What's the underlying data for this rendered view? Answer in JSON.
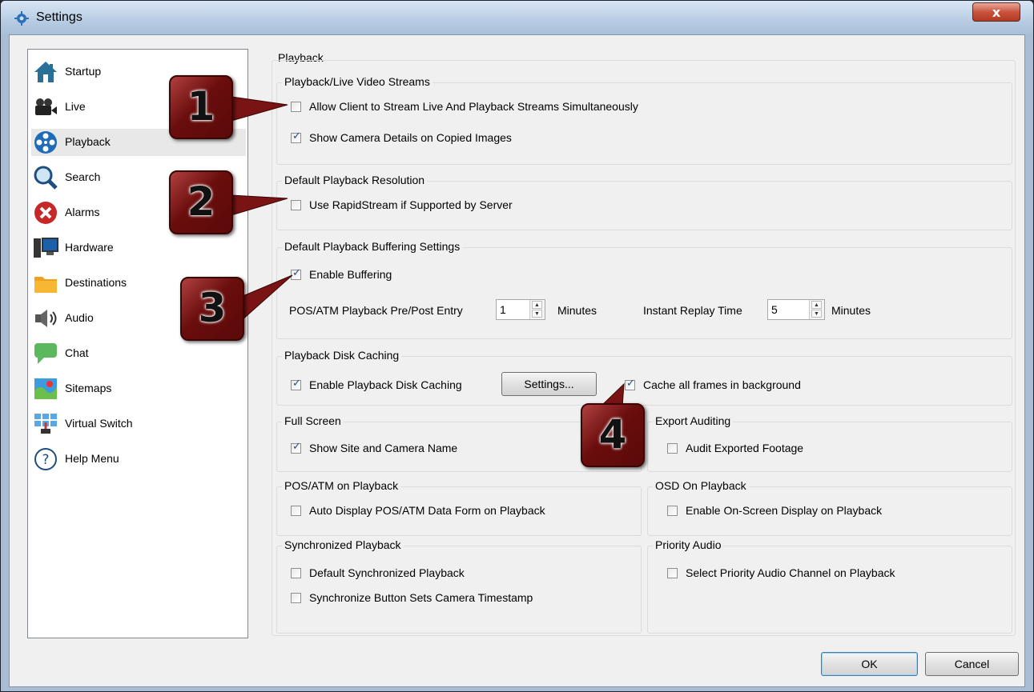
{
  "window": {
    "title": "Settings",
    "close_glyph": "x"
  },
  "sidebar": {
    "items": [
      {
        "label": "Startup",
        "icon": "house-icon"
      },
      {
        "label": "Live",
        "icon": "video-camera-icon"
      },
      {
        "label": "Playback",
        "icon": "film-reel-icon",
        "selected": true
      },
      {
        "label": "Search",
        "icon": "magnifier-icon"
      },
      {
        "label": "Alarms",
        "icon": "red-x-icon"
      },
      {
        "label": "Hardware",
        "icon": "computer-icon"
      },
      {
        "label": "Destinations",
        "icon": "folder-icon"
      },
      {
        "label": "Audio",
        "icon": "speaker-icon"
      },
      {
        "label": "Chat",
        "icon": "chat-bubble-icon"
      },
      {
        "label": "Sitemaps",
        "icon": "map-icon"
      },
      {
        "label": "Virtual Switch",
        "icon": "virtual-switch-icon"
      },
      {
        "label": "Help Menu",
        "icon": "help-icon"
      }
    ]
  },
  "panel": {
    "title": "Playback",
    "streams": {
      "title": "Playback/Live Video Streams",
      "allow_simultaneous": {
        "label": "Allow Client to Stream Live And Playback Streams Simultaneously",
        "checked": false
      },
      "camera_details": {
        "label": "Show Camera Details on Copied Images",
        "checked": true
      }
    },
    "resolution": {
      "title": "Default Playback Resolution",
      "rapidstream": {
        "label": "Use RapidStream if Supported by Server",
        "checked": false
      }
    },
    "buffering": {
      "title": "Default Playback Buffering Settings",
      "enable": {
        "label": "Enable Buffering",
        "checked": true
      },
      "pos_label": "POS/ATM Playback Pre/Post Entry",
      "pos_value": "1",
      "pos_unit": "Minutes",
      "replay_label": "Instant Replay Time",
      "replay_value": "5",
      "replay_unit": "Minutes"
    },
    "disk_caching": {
      "title": "Playback Disk Caching",
      "enable": {
        "label": "Enable Playback Disk Caching",
        "checked": true
      },
      "settings_button": "Settings...",
      "cache_all": {
        "label": "Cache all frames in background",
        "checked": true
      }
    },
    "full_screen": {
      "title": "Full Screen",
      "show_names": {
        "label": "Show Site and Camera Name",
        "checked": true
      }
    },
    "export_auditing": {
      "title": "Export Auditing",
      "audit": {
        "label": "Audit Exported Footage",
        "checked": false
      }
    },
    "pos_atm": {
      "title": "POS/ATM on Playback",
      "auto_display": {
        "label": "Auto Display POS/ATM Data Form on Playback",
        "checked": false
      }
    },
    "osd": {
      "title": "OSD On Playback",
      "enable": {
        "label": "Enable On-Screen Display on Playback",
        "checked": false
      }
    },
    "sync": {
      "title": "Synchronized Playback",
      "default_sync": {
        "label": "Default Synchronized Playback",
        "checked": false
      },
      "sync_timestamp": {
        "label": "Synchronize Button Sets Camera Timestamp",
        "checked": false
      }
    },
    "priority_audio": {
      "title": "Priority Audio",
      "select": {
        "label": "Select Priority Audio Channel on Playback",
        "checked": false
      }
    }
  },
  "footer": {
    "ok": "OK",
    "cancel": "Cancel"
  },
  "callouts": [
    "1",
    "2",
    "3",
    "4"
  ],
  "colors": {
    "callout": "#6a0d0d",
    "titlebar": "#b7cce3",
    "close": "#c8543d",
    "checkmark": "#2b4a8a"
  }
}
